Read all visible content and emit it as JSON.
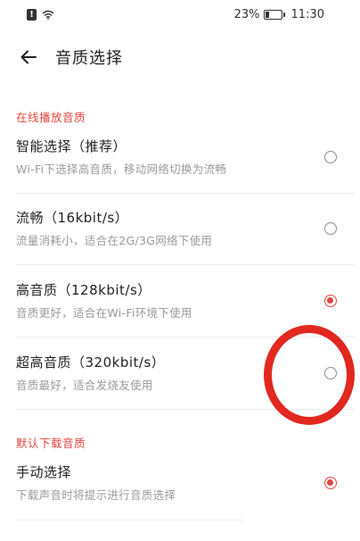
{
  "status_bar": {
    "battery_percent": "23%",
    "battery_level": 0.23,
    "time": "11:30",
    "icons": [
      "alert-icon",
      "wifi-icon",
      "battery-charging-icon"
    ]
  },
  "header": {
    "back_icon": "arrow-left-icon",
    "title": "音质选择"
  },
  "online_section": {
    "title": "在线播放音质",
    "options": [
      {
        "title": "智能选择（推荐）",
        "subtitle": "Wi-Fi下选择高音质，移动网络切换为流畅",
        "selected": false
      },
      {
        "title": "流畅（16kbit/s）",
        "subtitle": "流量消耗小，适合在2G/3G网络下使用",
        "selected": false
      },
      {
        "title": "高音质（128kbit/s）",
        "subtitle": "音质更好，适合在Wi-Fi环境下使用",
        "selected": true
      },
      {
        "title": "超高音质（320kbit/s）",
        "subtitle": "音质最好，适合发烧友使用",
        "selected": false
      }
    ]
  },
  "download_section": {
    "title": "默认下载音质",
    "options": [
      {
        "title": "手动选择",
        "subtitle": "下载声音时将提示进行音质选择",
        "selected": true
      }
    ]
  },
  "colors": {
    "accent": "#e4463d",
    "annotation": "#e1281f"
  }
}
